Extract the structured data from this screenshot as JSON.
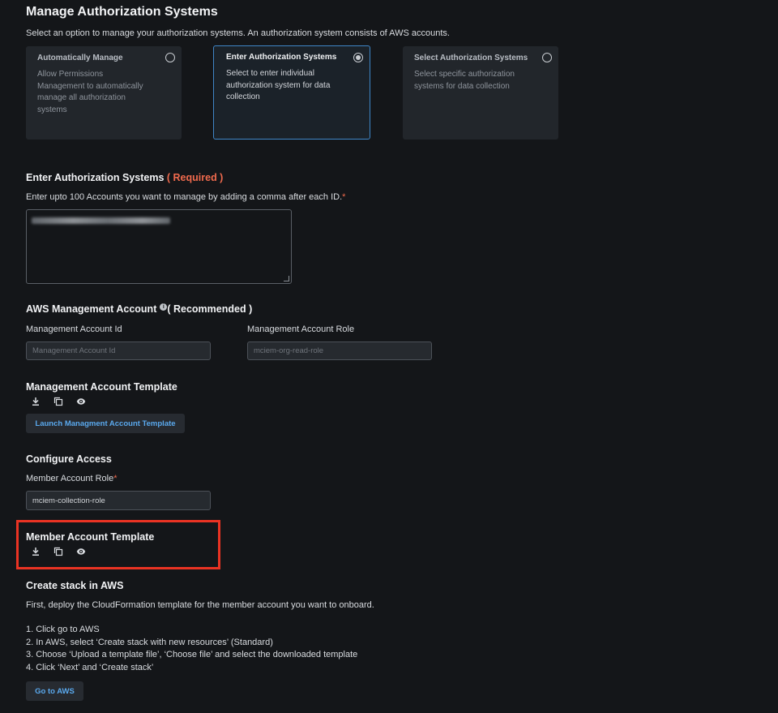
{
  "manage": {
    "title": "Manage Authorization Systems",
    "description": "Select an option to manage your authorization systems. An authorization system consists of AWS accounts.",
    "options": [
      {
        "title": "Automatically Manage",
        "desc": "Allow Permissions Management to automatically manage all authorization systems",
        "selected": false
      },
      {
        "title": "Enter Authorization Systems",
        "desc": "Select to enter individual authorization system for data collection",
        "selected": true
      },
      {
        "title": "Select Authorization Systems",
        "desc": "Select specific authorization systems for data collection",
        "selected": false
      }
    ]
  },
  "enter": {
    "title": "Enter Authorization Systems",
    "required_label": "( Required )",
    "description": "Enter upto 100 Accounts you want to manage by adding a comma after each ID.",
    "required_mark": "*"
  },
  "mgmt_account": {
    "title": "AWS Management Account",
    "info_icon": "info-icon",
    "recommended_label": "( Recommended )",
    "id_label": "Management Account Id",
    "id_placeholder": "Management Account Id",
    "role_label": "Management Account Role",
    "role_placeholder": "mciem-org-read-role"
  },
  "mgmt_template": {
    "title": "Management Account Template",
    "icons": [
      "download-icon",
      "copy-icon",
      "eye-icon"
    ],
    "launch_button": "Launch Managment Account Template"
  },
  "configure": {
    "title": "Configure Access",
    "role_label": "Member Account Role",
    "required_mark": "*",
    "role_value": "mciem-collection-role"
  },
  "member_template": {
    "title": "Member Account Template",
    "icons": [
      "download-icon",
      "copy-icon",
      "eye-icon"
    ]
  },
  "stack": {
    "title": "Create stack in AWS",
    "intro": "First, deploy the CloudFormation template for the member account you want to onboard.",
    "steps": [
      "1. Click go to AWS",
      "2. In AWS, select ‘Create stack with new resources’ (Standard)",
      "3. Choose ‘Upload a template file’, ‘Choose file’ and select the downloaded template",
      "4. Click ‘Next’ and ‘Create stack’"
    ],
    "go_button": "Go to AWS"
  },
  "colors": {
    "background": "#141619",
    "accent_blue": "#5aa9ee",
    "required_red": "#f06a4d",
    "highlight_red": "#ea3323",
    "selected_border": "#3f86c7"
  }
}
